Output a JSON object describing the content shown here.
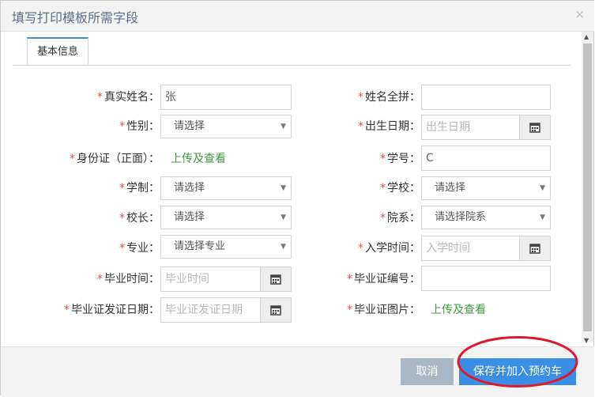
{
  "dialog": {
    "title": "填写打印模板所需字段",
    "close_glyph": "×"
  },
  "tabs": [
    {
      "label": "基本信息"
    }
  ],
  "fields": {
    "real_name": {
      "label": "真实姓名：",
      "value": "张"
    },
    "name_pinyin": {
      "label": "姓名全拼：",
      "value": ""
    },
    "gender": {
      "label": "性别：",
      "selected": "请选择"
    },
    "birth_date": {
      "label": "出生日期：",
      "placeholder": "出生日期"
    },
    "id_card": {
      "label": "身份证（正面）：",
      "link": "上传及查看"
    },
    "student_no": {
      "label": "学号：",
      "value": "C"
    },
    "school_system": {
      "label": "学制：",
      "selected": "请选择"
    },
    "school": {
      "label": "学校：",
      "selected": "请选择"
    },
    "principal": {
      "label": "校长：",
      "selected": "请选择"
    },
    "department": {
      "label": "院系：",
      "selected": "请选择院系"
    },
    "major": {
      "label": "专业：",
      "selected": "请选择专业"
    },
    "enroll_date": {
      "label": "入学时间：",
      "placeholder": "入学时间"
    },
    "grad_date": {
      "label": "毕业时间：",
      "placeholder": "毕业时间"
    },
    "cert_no": {
      "label": "毕业证编号：",
      "value": ""
    },
    "cert_issue_date": {
      "label": "毕业证发证日期：",
      "placeholder": "毕业证发证日期"
    },
    "cert_image": {
      "label": "毕业证图片：",
      "link": "上传及查看"
    }
  },
  "required_mark": "*",
  "buttons": {
    "cancel": "取消",
    "save": "保存并加入预约车"
  },
  "colors": {
    "primary": "#3b8ee6",
    "cancel": "#a9b6c3",
    "link": "#3f9a3f",
    "required": "#d9534f",
    "annotation": "#e0182d"
  }
}
